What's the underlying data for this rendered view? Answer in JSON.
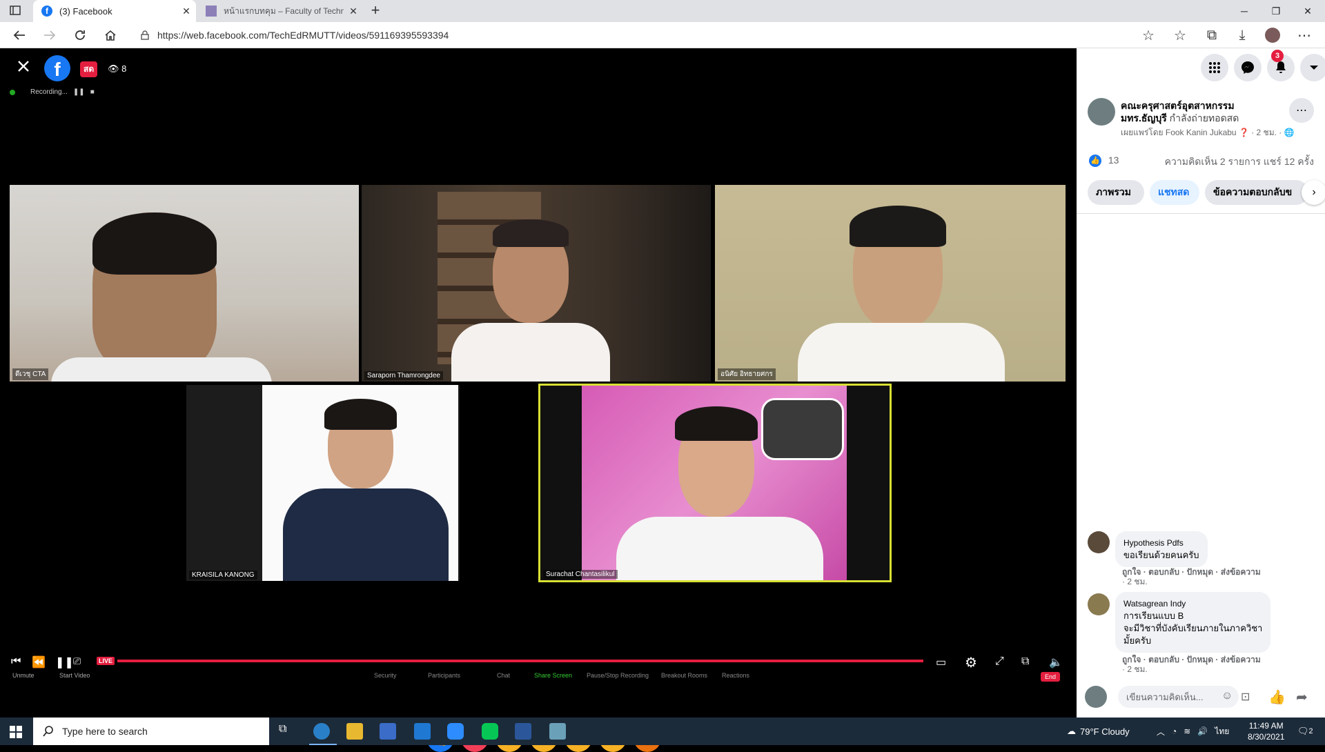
{
  "browser": {
    "tabs": [
      {
        "title": "(3) Facebook"
      },
      {
        "title": "หน้าแรกบทคุม – Faculty of Technical E"
      }
    ],
    "url": "https://web.facebook.com/TechEdRMUTT/videos/591169395593394"
  },
  "video": {
    "live_badge": "สด",
    "viewer_count": "8",
    "recording_label": "Recording...",
    "participants": [
      {
        "name": "ดีเวชุ CTA"
      },
      {
        "name": "Saraporn Thamrongdee"
      },
      {
        "name": "อนิศัย อิทธายศกร"
      },
      {
        "name": "KRAISILA KANONG"
      },
      {
        "name": "Surachat Chantasilikul"
      }
    ],
    "zoom_controls": [
      "Unmute",
      "Start Video",
      "Security",
      "Participants",
      "Chat",
      "Share Screen",
      "Pause/Stop Recording",
      "Breakout Rooms",
      "Reactions"
    ],
    "end_label": "End"
  },
  "panel": {
    "notification_count": "3",
    "page_name": "คณะครุศาสตร์อุตสาหกรรม มทร.ธัญบุรี",
    "status": "กำลังถ่ายทอดสด",
    "published_by": "เผยแพร่โดย Fook Kanin Jukabu",
    "published_time": "2 ชม.",
    "like_count": "13",
    "comment_share": "ความคิดเห็น 2 รายการ  แชร์ 12 ครั้ง",
    "tabs": [
      "ภาพรวม",
      "แชทสด",
      "ข้อความตอบกลับข"
    ],
    "comments": [
      {
        "author": "Hypothesis Pdfs",
        "text": "ขอเรียนด้วยคนครับ",
        "actions": "ถูกใจ · ตอบกลับ · ปักหมุด · ส่งข้อความ",
        "time": "· 2 ชม."
      },
      {
        "author": "Watsagrean Indy",
        "text1": "การเรียนแบบ B",
        "text2": "จะมีวิชาที่บังคับเรียนภายในภาควิชา",
        "text3": "มั้ยครับ",
        "actions": "ถูกใจ · ตอบกลับ · ปักหมุด · ส่งข้อความ",
        "time": "· 2 ชม."
      }
    ],
    "comment_placeholder": "เขียนความคิดเห็น..."
  },
  "taskbar": {
    "search_placeholder": "Type here to search",
    "weather": "79°F  Cloudy",
    "lang": "ไทย",
    "time": "11:49 AM",
    "date": "8/30/2021",
    "notif": "2"
  }
}
